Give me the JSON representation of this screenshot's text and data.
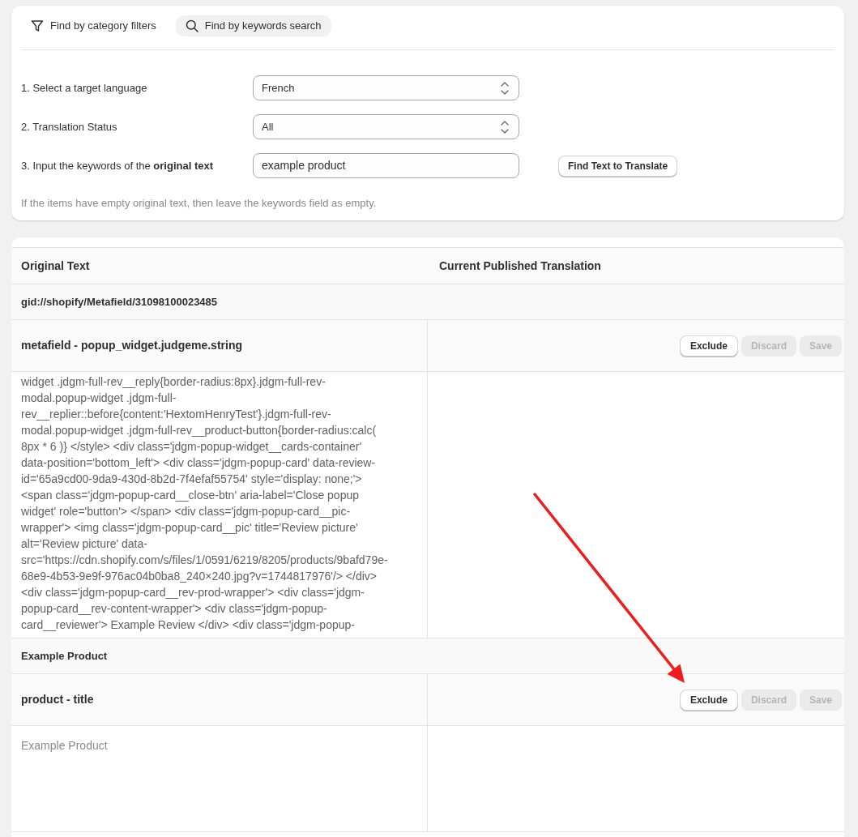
{
  "filter_tabs": [
    {
      "kind": "filter",
      "label": "Find by category filters",
      "selected": false
    },
    {
      "kind": "search",
      "label": "Find by keywords search",
      "selected": true
    }
  ],
  "form": {
    "fields": [
      {
        "kind": "select",
        "label": "1. Select a target language",
        "value": "French"
      },
      {
        "kind": "select",
        "label": "2. Translation Status",
        "value": "All"
      },
      {
        "kind": "input",
        "label": "3. Input the keywords of the **original text**",
        "value": "example product",
        "button": "Find Text to Translate"
      }
    ],
    "note": "If the items have empty original text, then leave the keywords field as empty."
  },
  "table": {
    "columns": [
      "Original Text",
      "Current Published Translation"
    ],
    "groups": [
      {
        "title": "gid://shopify/Metafield/31098100023485",
        "items": [
          {
            "field": "metafield - popup_widget.judgeme.string",
            "buttons": [
              {
                "label": "Exclude",
                "disabled": false
              },
              {
                "label": "Discard",
                "disabled": true
              },
              {
                "label": "Save",
                "disabled": true
              }
            ],
            "original_lines": [
              "widget .jdgm-full-rev__reply{border-radius:8px}.jdgm-full-rev-",
              "modal.popup-widget .jdgm-full-",
              "rev__replier::before{content:'HextomHenryTest'}.jdgm-full-rev-",
              "modal.popup-widget .jdgm-full-rev__product-button{border-radius:calc(",
              "8px * 6 )} </style> <div class='jdgm-popup-widget__cards-container'",
              "data-position='bottom_left'> <div class='jdgm-popup-card' data-review-",
              "id='65a9cd00-9da9-430d-8b2d-7f4efaf55754' style='display: none;'>",
              "<span class='jdgm-popup-card__close-btn' aria-label='Close popup",
              "widget' role='button'> </span> <div class='jdgm-popup-card__pic-",
              "wrapper'> <img class='jdgm-popup-card__pic' title='Review picture'",
              "alt='Review picture' data-",
              "src='https://cdn.shopify.com/s/files/1/0591/6219/8205/products/9bafd79e-",
              "68e9-4b53-9e9f-976ac04b0ba8_240×240.jpg?v=1744817976'/> </div>",
              "<div class='jdgm-popup-card__rev-prod-wrapper'> <div class='jdgm-",
              "popup-card__rev-content-wrapper'> <div class='jdgm-popup-",
              "card__reviewer'> Example Review </div> <div class='jdgm-popup-"
            ]
          }
        ]
      },
      {
        "title": "Example Product",
        "items": [
          {
            "field": "product - title",
            "buttons": [
              {
                "label": "Exclude",
                "disabled": false
              },
              {
                "label": "Discard",
                "disabled": true
              },
              {
                "label": "Save",
                "disabled": true
              }
            ],
            "original_lines": [
              "Example Product"
            ]
          }
        ]
      }
    ]
  }
}
